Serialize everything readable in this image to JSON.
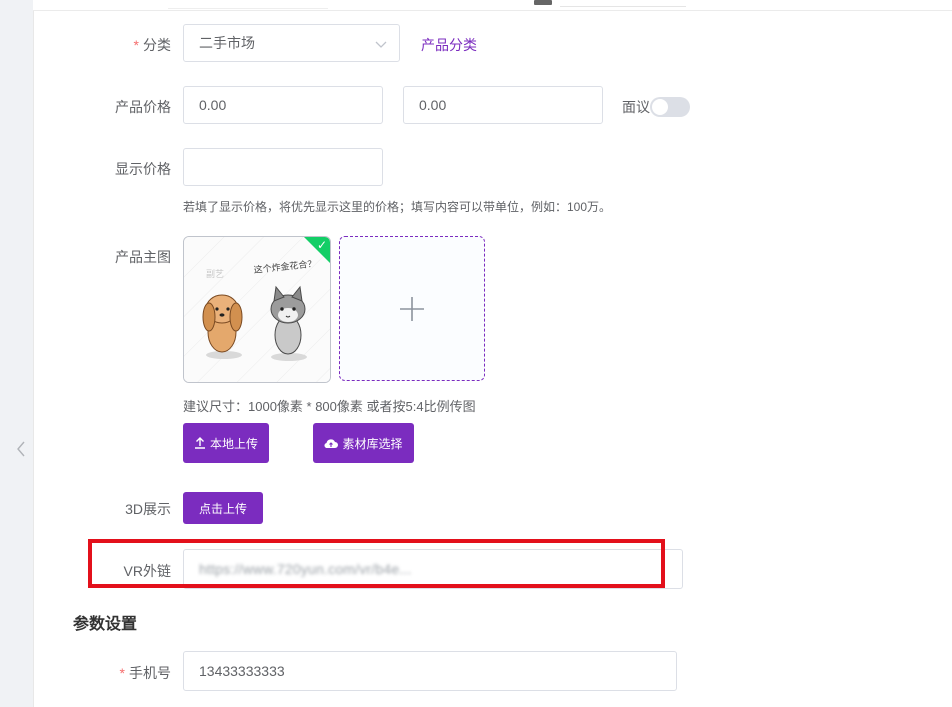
{
  "form": {
    "category": {
      "label": "分类",
      "required_mark": "*",
      "value": "二手市场",
      "link": "产品分类"
    },
    "price": {
      "label": "产品价格",
      "min_value": "0.00",
      "max_value": "0.00",
      "negotiable_label": "面议",
      "negotiable_on": false
    },
    "display_price": {
      "label": "显示价格",
      "value": "",
      "hint": "若填了显示价格，将优先显示这里的价格；填写内容可以带单位，例如：100万。"
    },
    "main_image": {
      "label": "产品主图",
      "size_hint": "建议尺寸：1000像素 * 800像素 或者按5:4比例传图",
      "local_upload": "本地上传",
      "library_select": "素材库选择",
      "thumb_caption": "这个炸金花合？",
      "thumb_watermark": "副艺"
    },
    "display_3d": {
      "label": "3D展示",
      "button": "点击上传"
    },
    "vr_link": {
      "label": "VR外链",
      "value": "https://www.720yun.com/vr/b4e..."
    }
  },
  "params": {
    "title": "参数设置",
    "phone": {
      "label": "手机号",
      "required_mark": "*",
      "value": "13433333333"
    }
  },
  "colors": {
    "primary": "#7b2cbf",
    "success": "#13ce66",
    "highlight": "#e3101b",
    "required": "#f56c6c"
  }
}
